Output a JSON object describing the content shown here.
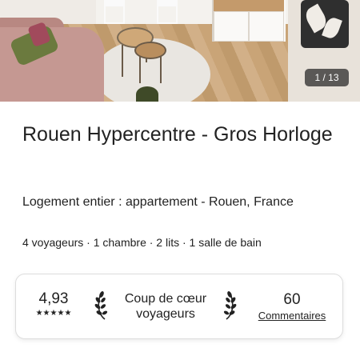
{
  "listing": {
    "photo_counter": "1 / 13",
    "title": "Rouen Hypercentre - Gros Horloge",
    "subtitle": "Logement entier : appartement - Rouen, France",
    "details": "4 voyageurs · 1 chambre · 2 lits · 1 salle de bain"
  },
  "stats": {
    "rating": "4,93",
    "stars": "★★★★★",
    "star_count": 5,
    "favorite_label": "Coup de cœur voyageurs",
    "reviews_count": "60",
    "reviews_label": "Commentaires"
  },
  "icons": {
    "laurel_left": "laurel-left-icon",
    "laurel_right": "laurel-right-icon"
  },
  "colors": {
    "text": "#222222",
    "border": "#dddddd",
    "counter_bg": "#222222"
  }
}
